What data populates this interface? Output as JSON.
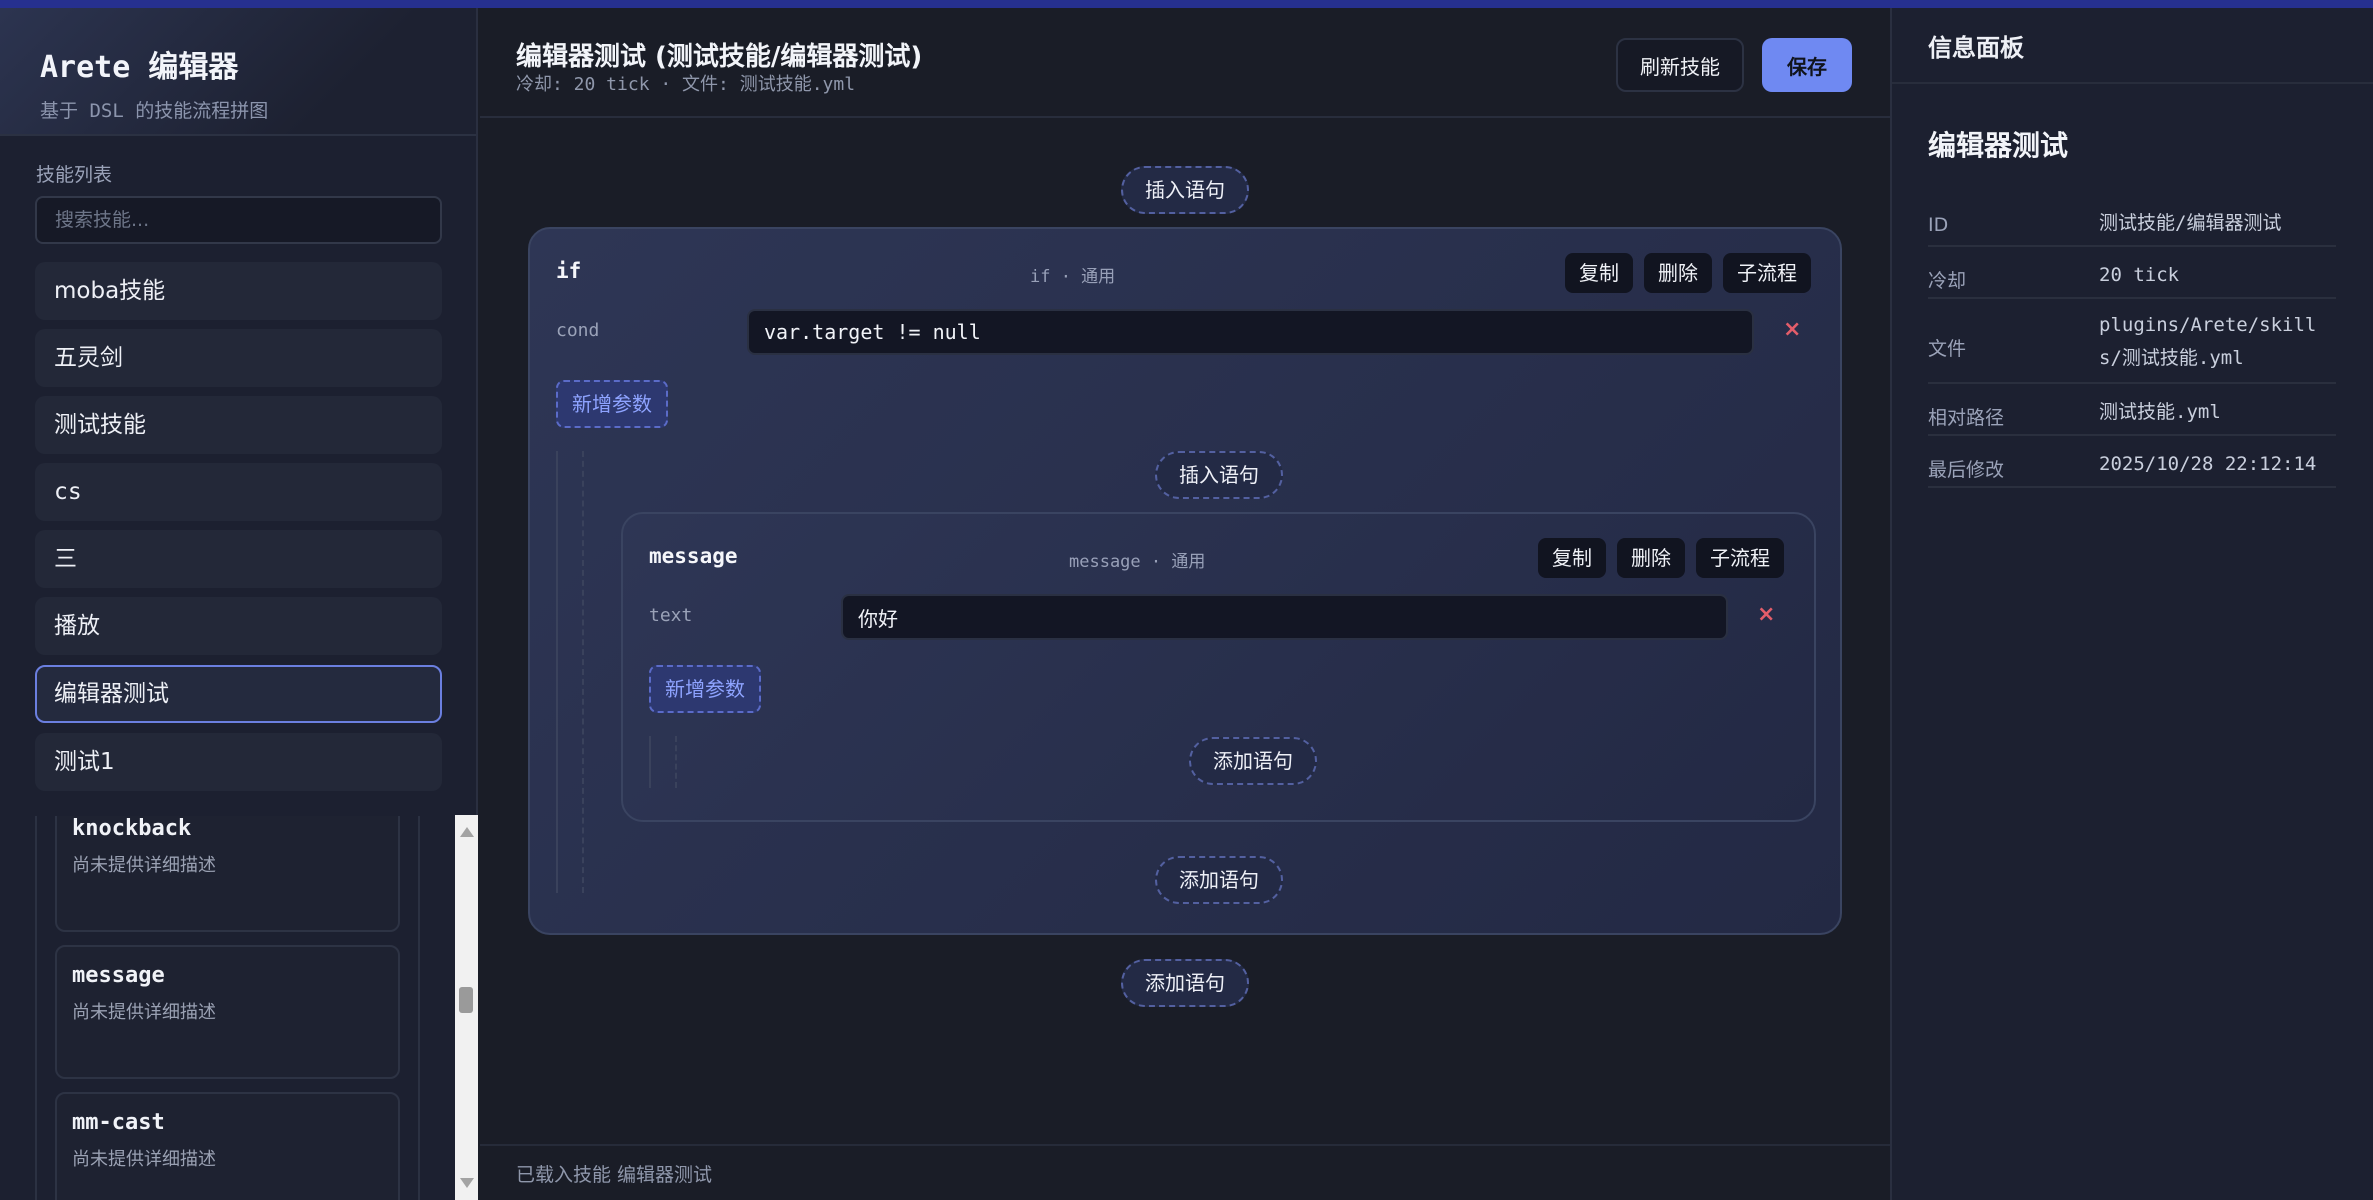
{
  "app": {
    "title": "Arete 编辑器",
    "subtitle": "基于 DSL 的技能流程拼图"
  },
  "sidebar": {
    "list_heading": "技能列表",
    "search_placeholder": "搜索技能...",
    "skills": [
      "moba技能",
      "五灵剑",
      "测试技能",
      "cs",
      "三",
      "播放",
      "编辑器测试",
      "测试1"
    ],
    "active_skill": "编辑器测试",
    "palette": [
      {
        "title": "knockback",
        "desc": "尚未提供详细描述"
      },
      {
        "title": "message",
        "desc": "尚未提供详细描述"
      },
      {
        "title": "mm-cast",
        "desc": "尚未提供详细描述"
      }
    ]
  },
  "main": {
    "title": "编辑器测试 (测试技能/编辑器测试)",
    "subtitle": "冷却: 20 tick · 文件: 测试技能.yml",
    "refresh_label": "刷新技能",
    "save_label": "保存",
    "insert_label": "插入语句",
    "add_label": "添加语句",
    "add_param_label": "新增参数",
    "copy_label": "复制",
    "delete_label": "删除",
    "subflow_label": "子流程",
    "delete_glyph": "×",
    "if_block": {
      "name": "if",
      "meta": "if · 通用",
      "param_key": "cond",
      "param_value": "var.target != null"
    },
    "message_block": {
      "name": "message",
      "meta": "message · 通用",
      "param_key": "text",
      "param_value": "你好"
    },
    "status": "已载入技能 编辑器测试"
  },
  "info": {
    "heading": "信息面板",
    "title": "编辑器测试",
    "rows": [
      {
        "key": "ID",
        "value": "测试技能/编辑器测试"
      },
      {
        "key": "冷却",
        "value": "20 tick"
      },
      {
        "key": "文件",
        "value": "plugins/Arete/skills/测试技能.yml"
      },
      {
        "key": "相对路径",
        "value": "测试技能.yml"
      },
      {
        "key": "最后修改",
        "value": "2025/10/28 22:12:14"
      }
    ]
  },
  "colors": {
    "accent": "#6f89f2",
    "background": "#1a1d27",
    "delete": "#e35d6a"
  }
}
